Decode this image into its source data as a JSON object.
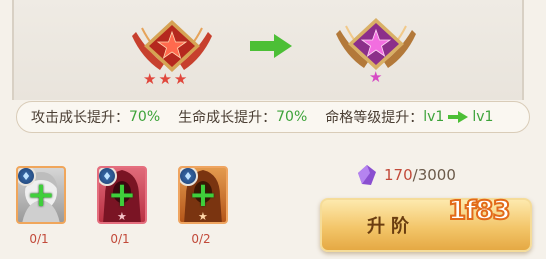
{
  "emblems": {
    "current": {
      "name": "red-star-emblem",
      "stars": 3,
      "color": "#d63b2c"
    },
    "next": {
      "name": "purple-star-emblem",
      "stars": 1,
      "color": "#d03bb5"
    }
  },
  "stats": {
    "attack_label": "攻击成长提升：",
    "attack_value": "70%",
    "hp_label": "生命成长提升：",
    "hp_value": "70%",
    "rank_label": "命格等级提升：",
    "rank_from": "lv1",
    "rank_to": "lv1"
  },
  "materials": [
    {
      "name": "material-slot-1",
      "count": "0/1",
      "stars": 0
    },
    {
      "name": "material-slot-2",
      "count": "0/1",
      "stars": 1
    },
    {
      "name": "material-slot-3",
      "count": "0/2",
      "stars": 1
    }
  ],
  "currency": {
    "have": "170",
    "need": "/3000",
    "icon": "purple-crystal-icon"
  },
  "upgrade_button": {
    "label": "升阶"
  },
  "watermark": {
    "text": "1f83"
  },
  "colors": {
    "green": "#3da33a",
    "red": "#c24a3a",
    "button": "#f3c66a"
  }
}
